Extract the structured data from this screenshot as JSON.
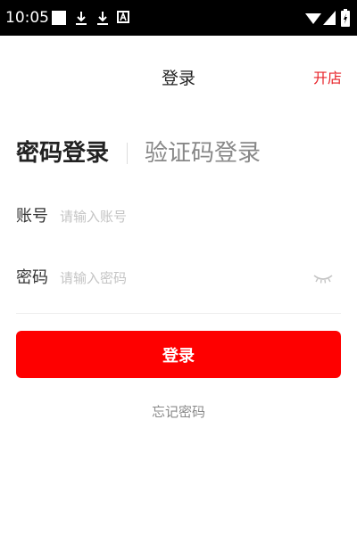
{
  "status_bar": {
    "time": "10:05",
    "icons": [
      "notification-square-icon",
      "download-icon",
      "download-icon",
      "a-badge-icon",
      "wifi-icon",
      "cell-signal-icon",
      "battery-charging-icon"
    ]
  },
  "header": {
    "title": "登录",
    "action_label": "开店"
  },
  "tabs": {
    "password_login": "密码登录",
    "sms_login": "验证码登录",
    "active": "password_login"
  },
  "form": {
    "account": {
      "label": "账号",
      "value": "",
      "placeholder": "请输入账号"
    },
    "password": {
      "label": "密码",
      "value": "",
      "placeholder": "请输入密码",
      "toggle_icon": "eye-closed-icon"
    }
  },
  "actions": {
    "login_label": "登录",
    "forgot_password_label": "忘记密码"
  },
  "colors": {
    "accent": "#fe0000",
    "header_action": "#e8242a",
    "status_bar_bg": "#000000",
    "text_primary": "#222222",
    "text_muted": "#888888",
    "placeholder": "#c4c4c4"
  }
}
